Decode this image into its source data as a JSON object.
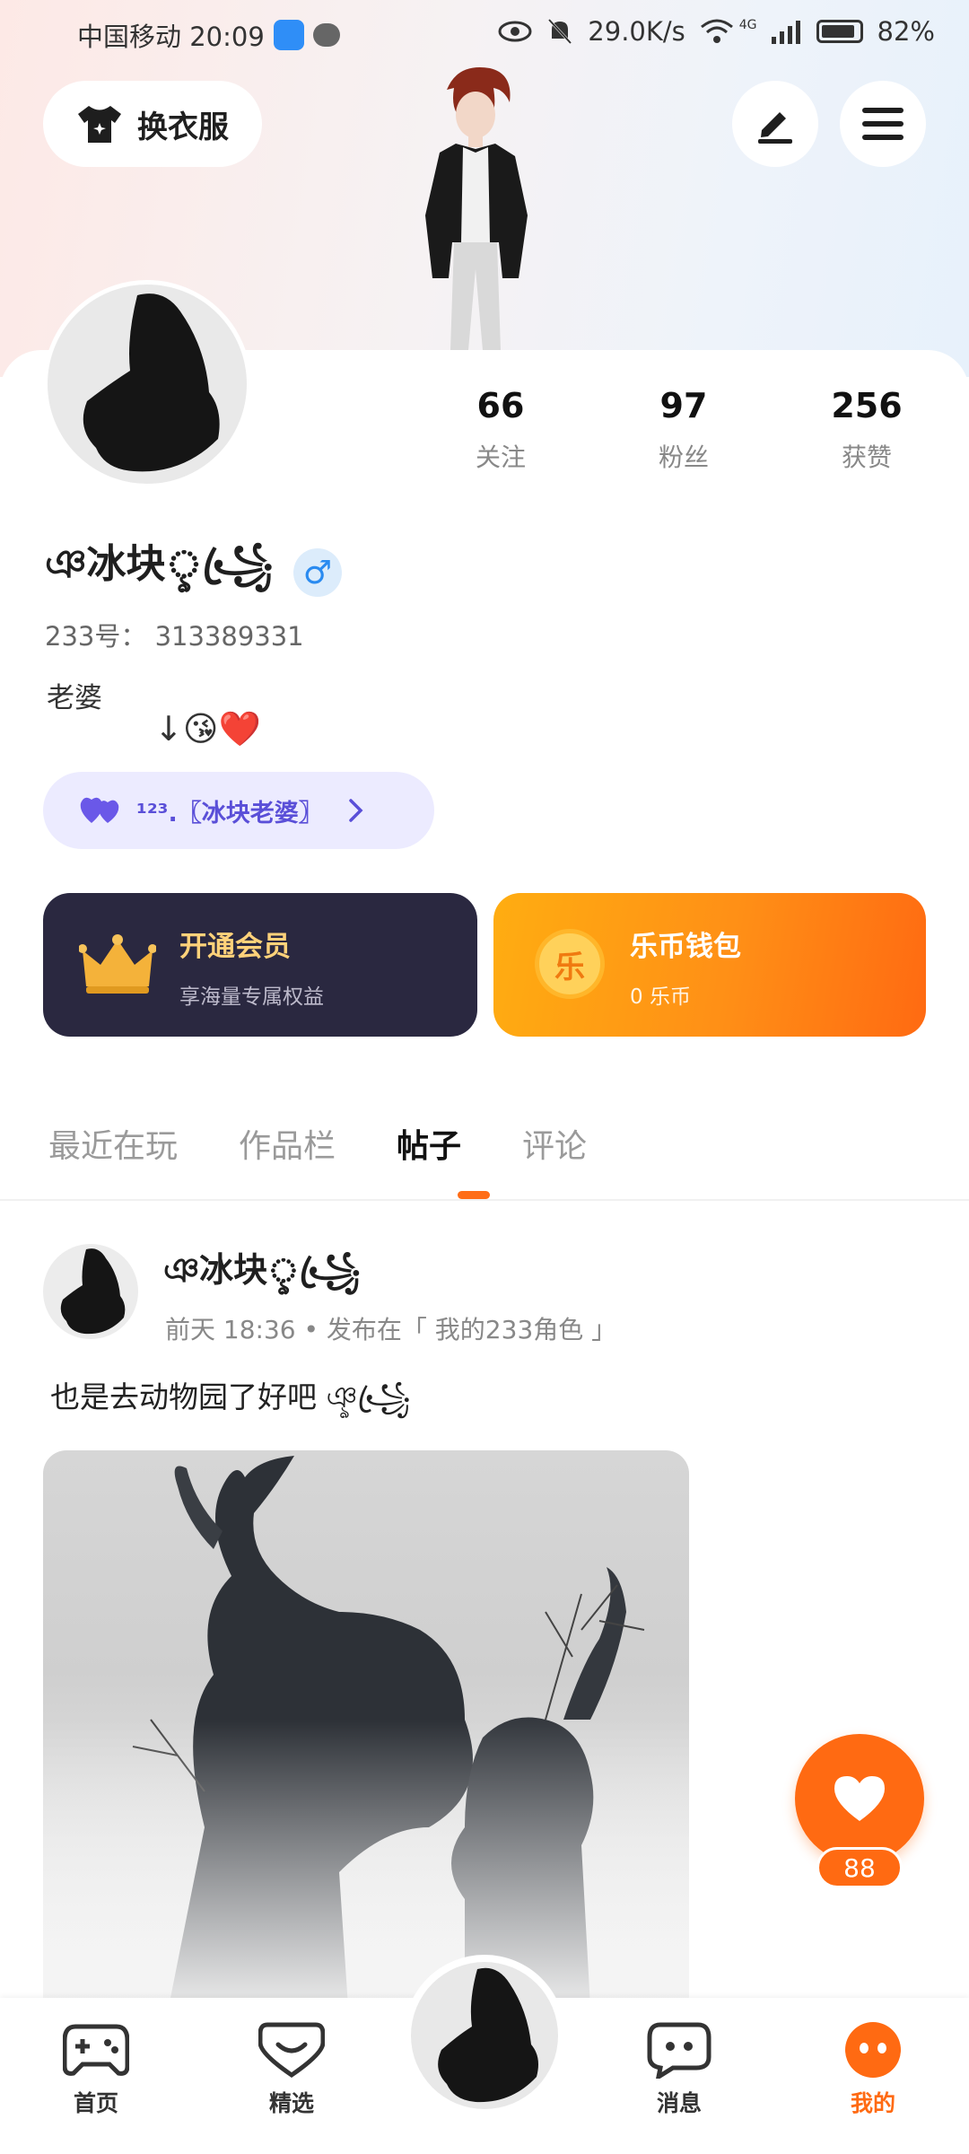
{
  "status_bar": {
    "carrier_time": "中国移动 20:09",
    "speed": "29.0K/s",
    "network": "4G",
    "battery": "82%"
  },
  "header": {
    "outfit_label": "换衣服",
    "icons": [
      "shirt-icon",
      "edit-icon",
      "menu-icon"
    ]
  },
  "profile": {
    "stats": [
      {
        "value": "66",
        "label": "关注"
      },
      {
        "value": "97",
        "label": "粉丝"
      },
      {
        "value": "256",
        "label": "获赞"
      }
    ],
    "name": "ঞ冰块ৢ꧁ꦿ",
    "gender": "♂",
    "id_line": "233号：  313389331",
    "bio_line1": "老婆",
    "bio_line2": "↓😘❤️",
    "family_tag": "¹²³.〖冰块老婆〗"
  },
  "cards": {
    "vip_title": "开通会员",
    "vip_sub": "享海量专属权益",
    "wallet_title": "乐币钱包",
    "wallet_sub": "0 乐币",
    "wallet_coin": "乐"
  },
  "tabs": [
    {
      "label": "最近在玩"
    },
    {
      "label": "作品栏"
    },
    {
      "label": "帖子"
    },
    {
      "label": "评论"
    }
  ],
  "post": {
    "author": "ঞ冰块ৢ꧁ꦿ",
    "meta": "前天 18:36 • 发布在「 我的233角色 」",
    "text": "也是去动物园了好吧 ঞৢ꧁ꦿ"
  },
  "like": {
    "count": "88"
  },
  "bottom_nav": [
    {
      "label": "首页",
      "icon": "gamepad-icon"
    },
    {
      "label": "精选",
      "icon": "heart-outline-icon"
    },
    {
      "label": "消息",
      "icon": "chat-icon"
    },
    {
      "label": "我的",
      "icon": "me-icon"
    }
  ],
  "colors": {
    "accent": "#ff6a12",
    "vip_bg": "#2a2840",
    "vip_text": "#ffd27a",
    "family_tag_text": "#5a4fd8"
  }
}
